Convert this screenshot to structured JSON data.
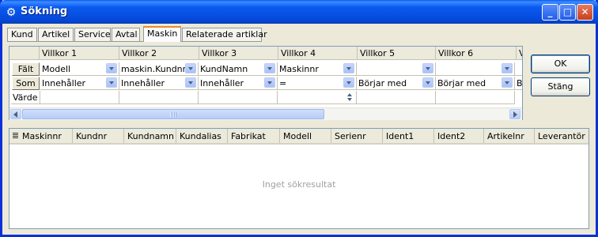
{
  "window": {
    "title": "Sökning"
  },
  "tabs": [
    "Kund",
    "Artikel",
    "Service",
    "Avtal",
    "Maskin",
    "Relaterade artiklar"
  ],
  "active_tab": "Maskin",
  "criteria": {
    "columns": [
      "Villkor 1",
      "Villkor 2",
      "Villkor 3",
      "Villkor 4",
      "Villkor 5",
      "Villkor 6",
      "V"
    ],
    "row_labels": {
      "field": "Fält",
      "operator": "Som",
      "value": "Värde"
    },
    "fields": [
      "Modell",
      "maskin.Kundnr",
      "KundNamn",
      "Maskinnr",
      "",
      ""
    ],
    "operators": [
      "Innehåller",
      "Innehåller",
      "Innehåller",
      "=",
      "Börjar med",
      "Börjar med",
      "B"
    ],
    "values": [
      "",
      "",
      "",
      "",
      "",
      ""
    ]
  },
  "buttons": {
    "ok": "OK",
    "close": "Stäng"
  },
  "results": {
    "columns": [
      "Maskinnr",
      "Kundnr",
      "Kundnamn",
      "Kundalias",
      "Fabrikat",
      "Modell",
      "Serienr",
      "Ident1",
      "Ident2",
      "Artikelnr",
      "Leverantör"
    ],
    "empty_text": "Inget sökresultat"
  },
  "colors": {
    "title_bar": "#0a5bf0",
    "window_bg": "#ece9d8",
    "active_tab_accent": "#e68b2c"
  }
}
